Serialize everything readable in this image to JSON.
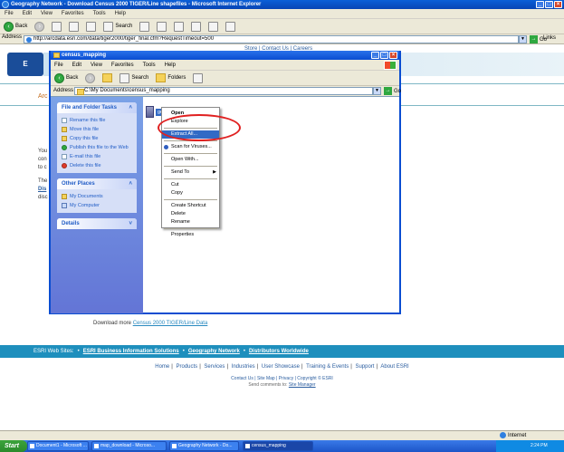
{
  "ie": {
    "title": "Geography Network - Download Census 2000 TIGER/Line shapefiles - Microsoft Internet Explorer",
    "menu": [
      "File",
      "Edit",
      "View",
      "Favorites",
      "Tools",
      "Help"
    ],
    "toolbar": {
      "back": "Back",
      "search": "Search"
    },
    "address_label": "Address",
    "address_value": "http://arcdata.esri.com/data/tiger2000/tiger_final.cfm?RequestTimeout=500",
    "go_label": "Go",
    "links_label": "Links",
    "status_zone": "Internet"
  },
  "webpage": {
    "top_links": "Store  |  Contact Us  |  Careers",
    "logo_text": "E",
    "heading_fragment": "Arc",
    "side_text": [
      "You",
      "con",
      "to c",
      "The",
      "Dis",
      "disc"
    ],
    "download_more_prefix": "Download more",
    "download_more_link": "Census 2000 TIGER/Line Data",
    "web_sites_label": "ESRI Web Sites:",
    "web_sites_links": [
      "ESRI Business Information Solutions",
      "Geography Network",
      "Distributors Worldwide"
    ],
    "footer_nav": [
      "Home",
      "Products",
      "Services",
      "Industries",
      "User Showcase",
      "Training & Events",
      "Support",
      "About ESRI"
    ],
    "footer_small": [
      "Contact Us",
      "Site Map",
      "Privacy",
      "Copyright © ESRI"
    ],
    "footer_send_prefix": "Send comments to:",
    "footer_send_link": "Site Manager"
  },
  "explorer": {
    "title": "census_mapping",
    "menu": [
      "File",
      "Edit",
      "View",
      "Favorites",
      "Tools",
      "Help"
    ],
    "toolbar": {
      "back": "Back",
      "search": "Search",
      "folders": "Folders"
    },
    "address_label": "Address",
    "address_value": "C:\\My Documents\\census_mapping",
    "go_label": "Go",
    "file_name": "geology_tract_map",
    "panels": {
      "file_tasks": {
        "title": "File and Folder Tasks",
        "items": [
          "Rename this file",
          "Move this file",
          "Copy this file",
          "Publish this file to the Web",
          "E-mail this file",
          "Delete this file"
        ]
      },
      "other_places": {
        "title": "Other Places",
        "items": [
          "My Documents",
          "My Computer"
        ]
      },
      "details": {
        "title": "Details"
      }
    }
  },
  "context_menu": {
    "items": [
      "Open",
      "Explore",
      "Extract All...",
      "Scan for Viruses...",
      "Open With...",
      "Send To",
      "Cut",
      "Copy",
      "Create Shortcut",
      "Delete",
      "Rename",
      "Properties"
    ],
    "highlighted": "Extract All..."
  },
  "taskbar": {
    "start": "Start",
    "tasks": [
      "Document1 - Microsoft ...",
      "map_download - Microso...",
      "Geography Network - Do...",
      "census_mapping"
    ],
    "clock": "2:24 PM"
  },
  "colors": {
    "xp_blue": "#0a4dd1",
    "selection": "#316ac5",
    "annotation_red": "#e02020",
    "esri_band": "#1e8fbd"
  }
}
